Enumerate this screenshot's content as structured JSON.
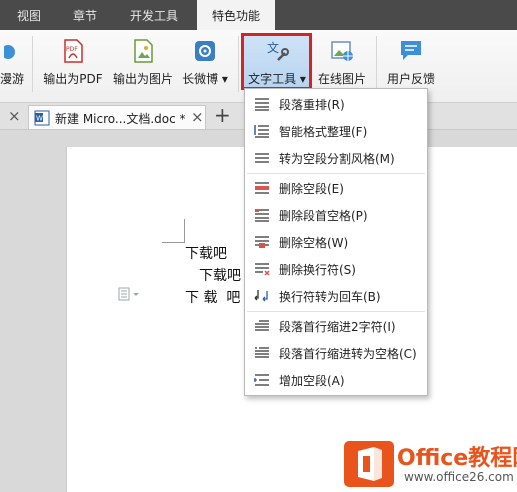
{
  "menubar": {
    "tabs": [
      {
        "label": "视图"
      },
      {
        "label": "章节"
      },
      {
        "label": "开发工具"
      },
      {
        "label": "特色功能"
      }
    ]
  },
  "ribbon": {
    "partial_label": "漫游",
    "buttons": [
      {
        "label": "输出为PDF"
      },
      {
        "label": "输出为图片"
      },
      {
        "label": "长微博 ▾"
      },
      {
        "label": "文字工具 ▾"
      },
      {
        "label": "在线图片"
      },
      {
        "label": "用户反馈"
      }
    ]
  },
  "docstrip": {
    "close_left": "×",
    "tab_title": "新建 Micro...文档.doc *",
    "tab_close": "×",
    "add": "+"
  },
  "document": {
    "lines": [
      "下载吧",
      "下载吧",
      "下 载  吧"
    ]
  },
  "dropdown": {
    "items": [
      {
        "label": "段落重排(R)"
      },
      {
        "label": "智能格式整理(F)"
      },
      {
        "label": "转为空段分割风格(M)"
      },
      {
        "label": "删除空段(E)"
      },
      {
        "label": "删除段首空格(P)"
      },
      {
        "label": "删除空格(W)"
      },
      {
        "label": "删除换行符(S)"
      },
      {
        "label": "换行符转为回车(B)"
      },
      {
        "label": "段落首行缩进2字符(I)"
      },
      {
        "label": "段落首行缩进转为空格(C)"
      },
      {
        "label": "增加空段(A)"
      }
    ]
  },
  "watermark": {
    "brand": "Office教程网",
    "url": "www.office26.com"
  },
  "colors": {
    "highlight_border": "#d42424",
    "watermark_orange": "#e8541c",
    "menubar_bg": "#4a4a4a"
  }
}
